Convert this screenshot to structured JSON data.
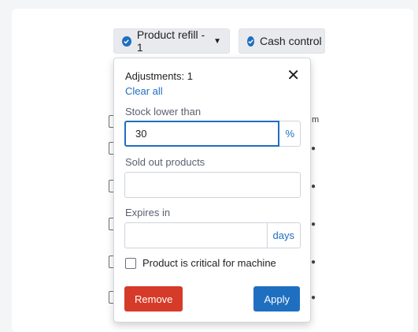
{
  "filters": {
    "chip1_label": "Product refill - 1",
    "chip2_label": "Cash control"
  },
  "background": {
    "column_header_fragment": "m"
  },
  "panel": {
    "title": "Adjustments: 1",
    "clear_all": "Clear all",
    "stock_lower_label": "Stock lower than",
    "stock_lower_value": "30",
    "stock_lower_suffix": "%",
    "sold_out_label": "Sold out products",
    "sold_out_value": "",
    "expires_label": "Expires in",
    "expires_value": "",
    "expires_suffix": "days",
    "critical_label": "Product is critical for machine",
    "critical_checked": false,
    "remove_label": "Remove",
    "apply_label": "Apply"
  },
  "colors": {
    "accent": "#1f6fc1",
    "danger": "#d63a28",
    "chip_bg": "#e8eaee"
  },
  "icons": {
    "chip": "check-circle-icon",
    "dropdown": "caret-down-icon",
    "close": "close-icon",
    "row": "person-icon"
  }
}
